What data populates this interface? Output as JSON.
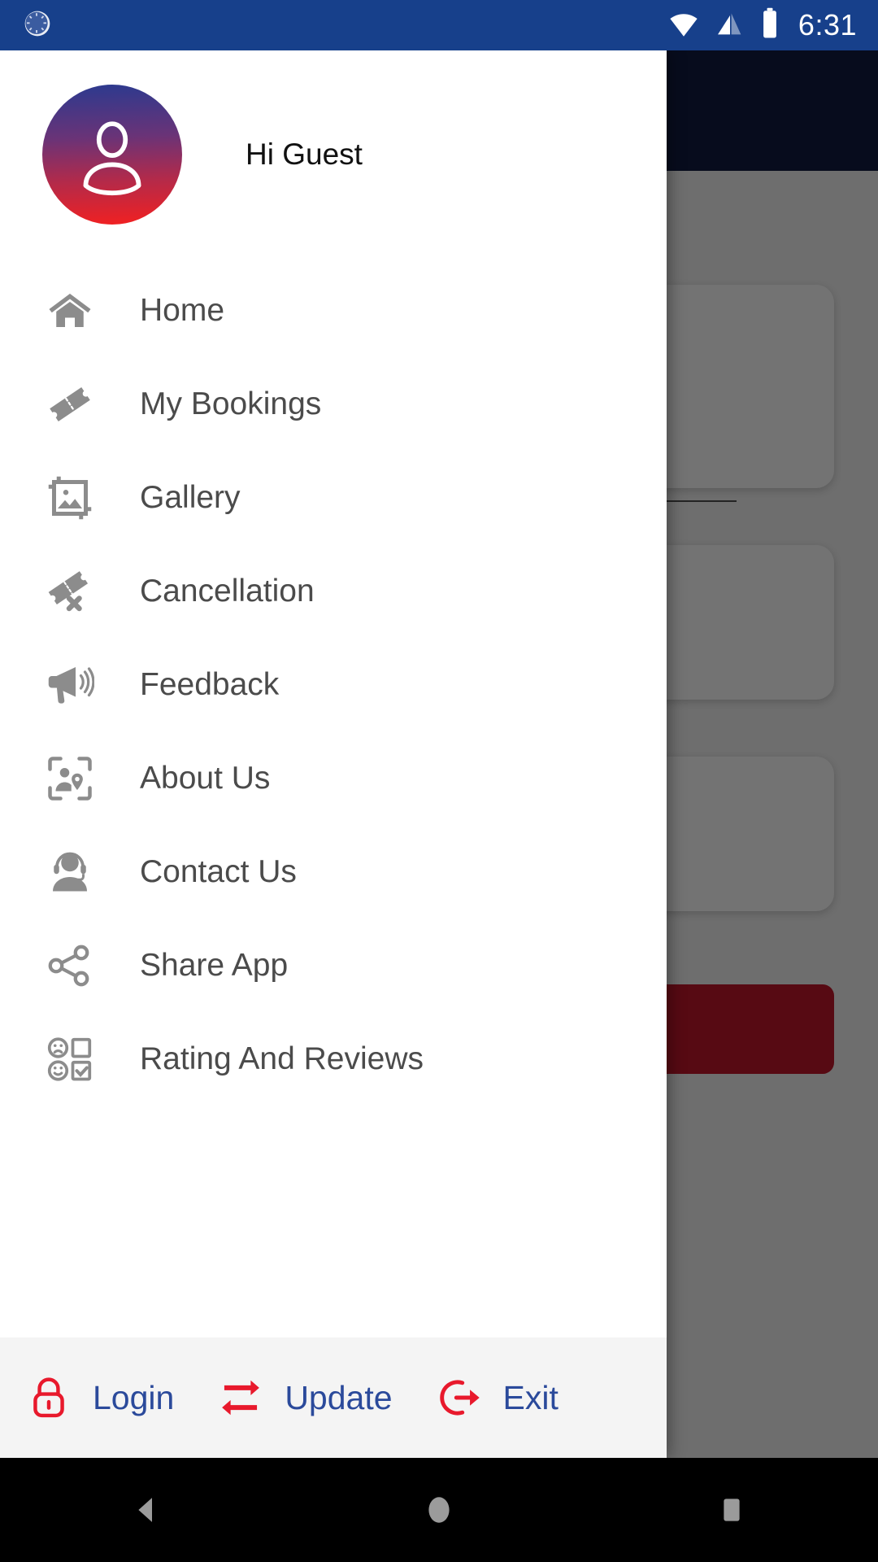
{
  "status_bar": {
    "time": "6:31",
    "background_color": "#17408b",
    "icons": [
      {
        "name": "notification-spinner-icon"
      },
      {
        "name": "wifi-icon"
      },
      {
        "name": "cellular-signal-icon"
      },
      {
        "name": "battery-icon"
      }
    ]
  },
  "drawer": {
    "background_color": "#ffffff",
    "header": {
      "greeting": "Hi Guest",
      "avatar": {
        "icon": "person-avatar-icon",
        "gradient_start": "#2b3a8f",
        "gradient_end": "#f32020"
      }
    },
    "menu_items": [
      {
        "label": "Home",
        "icon": "home-icon"
      },
      {
        "label": "My Bookings",
        "icon": "ticket-icon"
      },
      {
        "label": "Gallery",
        "icon": "image-crop-icon"
      },
      {
        "label": "Cancellation",
        "icon": "ticket-cancel-icon"
      },
      {
        "label": "Feedback",
        "icon": "megaphone-icon"
      },
      {
        "label": "About Us",
        "icon": "person-location-frame-icon"
      },
      {
        "label": "Contact Us",
        "icon": "headset-support-icon"
      },
      {
        "label": "Share App",
        "icon": "share-network-icon"
      },
      {
        "label": "Rating And Reviews",
        "icon": "survey-smiley-icon"
      }
    ],
    "footer": {
      "background_color": "#f4f4f4",
      "label_color": "#2b4a9b",
      "icon_color": "#e8192c",
      "buttons": [
        {
          "label": "Login",
          "icon": "lock-icon"
        },
        {
          "label": "Update",
          "icon": "swap-arrows-icon"
        },
        {
          "label": "Exit",
          "icon": "logout-icon"
        }
      ]
    }
  },
  "background_app": {
    "appbar_color": "#101c40",
    "swap_button_icon": "swap-vertical-icon",
    "cta_color": "#c0182a"
  },
  "navigation_bar": {
    "background_color": "#000000",
    "buttons": [
      {
        "name": "back",
        "icon": "back-triangle-icon"
      },
      {
        "name": "home",
        "icon": "home-circle-icon"
      },
      {
        "name": "recents",
        "icon": "recents-square-icon"
      }
    ]
  }
}
